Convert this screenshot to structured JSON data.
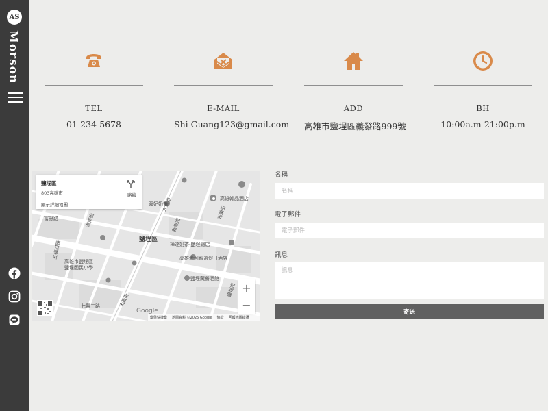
{
  "brand": {
    "monogram": "AS",
    "name": "Morson"
  },
  "colors": {
    "accent": "#d98a4a",
    "sidebar": "#3b3b3b",
    "background": "#ededeb",
    "button": "#606060"
  },
  "social": [
    {
      "icon": "facebook-icon"
    },
    {
      "icon": "instagram-icon"
    },
    {
      "icon": "line-icon"
    }
  ],
  "contact": [
    {
      "icon": "telephone-icon",
      "label": "TEL",
      "value": "01-234-5678"
    },
    {
      "icon": "envelope-icon",
      "label": "E-MAIL",
      "value": "Shi Guang123@gmail.com"
    },
    {
      "icon": "house-icon",
      "label": "ADD",
      "value": "高雄市鹽埕區義發路999號"
    },
    {
      "icon": "clock-icon",
      "label": "BH",
      "value": "10:00a.m-21:00p.m"
    }
  ],
  "map": {
    "place_title": "鹽埕區",
    "place_address": "803高雄市",
    "view_larger": "顯示詳細地圖",
    "route_label": "路線",
    "labels": {
      "district": "鹽埕區",
      "hotel": "高雄翰品酒店",
      "milk_tea": "双妃奶茶",
      "tea_shop": "樺達奶茶-鹽埕總店",
      "holiday_inn": "高雄愛河智選假日酒店",
      "restaurant": "鹽埕藏餐酒館",
      "school_1": "高雄市鹽埕區",
      "school_2": "鹽埕國民小學",
      "road_1": "大勇路",
      "road_2": "五福四路",
      "road_3": "光榮街",
      "road_4": "新樂街",
      "road_5": "大義街",
      "road_6": "七賢三路",
      "road_7": "鹽埕街",
      "road_8": "瀨南街",
      "road_9": "富野路"
    },
    "google": "Google",
    "footer": [
      "鍵盤快捷鍵",
      "地圖資料 ©2025 Google",
      "條款",
      "回報地圖錯誤"
    ],
    "zoom_in": "+",
    "zoom_out": "−"
  },
  "form": {
    "name_label": "名稱",
    "name_placeholder": "名稱",
    "email_label": "電子郵件",
    "email_placeholder": "電子郵件",
    "message_label": "訊息",
    "message_placeholder": "訊息",
    "submit_label": "寄送"
  }
}
